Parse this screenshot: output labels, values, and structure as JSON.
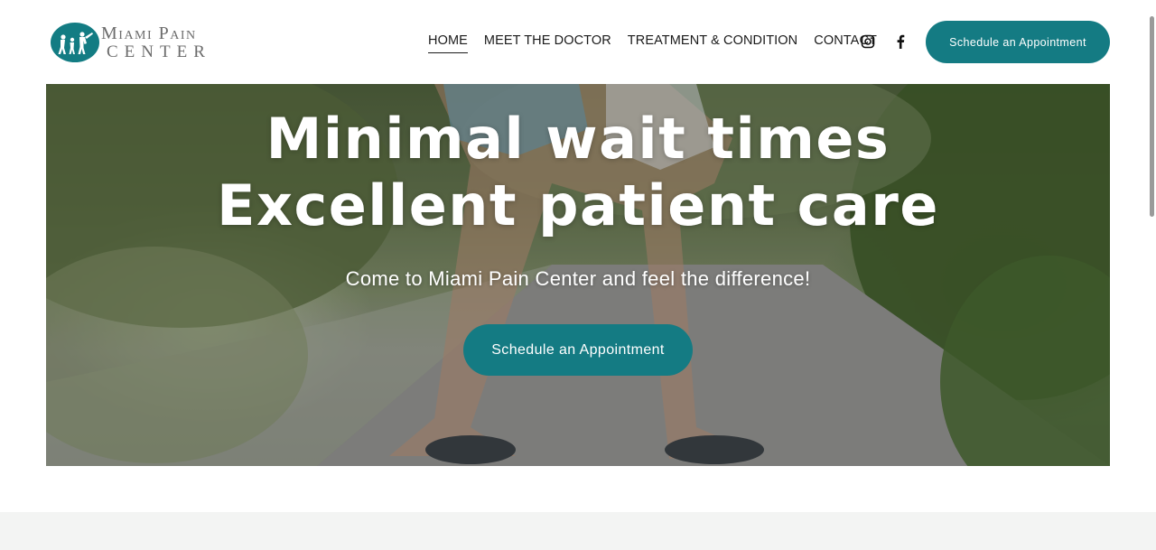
{
  "brand": {
    "line1": "Miami Pain",
    "line2": "CENTER",
    "logo_icon": "family-figures-icon",
    "color": "#147b83"
  },
  "nav": {
    "items": [
      {
        "label": "HOME",
        "active": true
      },
      {
        "label": "MEET THE DOCTOR",
        "active": false
      },
      {
        "label": "TREATMENT & CONDITION",
        "active": false
      },
      {
        "label": "CONTACT",
        "active": false
      }
    ]
  },
  "social": {
    "icons": [
      "instagram-icon",
      "facebook-icon"
    ]
  },
  "header_cta": {
    "label": "Schedule an Appointment"
  },
  "hero": {
    "title_line1": "Minimal wait times",
    "title_line2": "Excellent patient care",
    "subtitle": "Come to Miami Pain Center and feel the difference!",
    "cta_label": "Schedule an Appointment"
  }
}
